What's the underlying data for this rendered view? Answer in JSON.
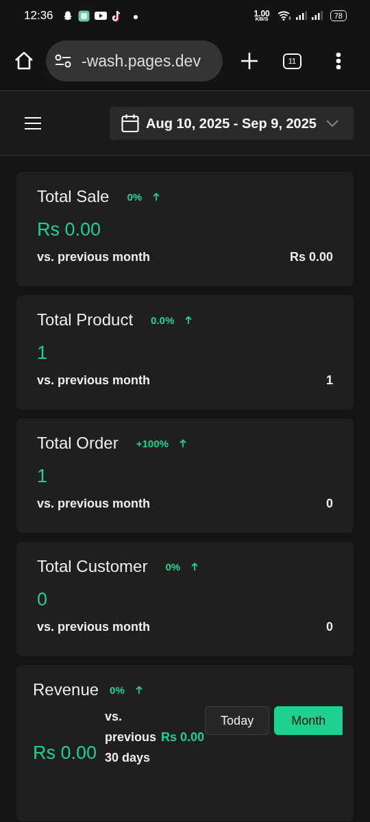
{
  "status_bar": {
    "time": "12:36",
    "speed_value": "1.00",
    "speed_unit": "KB/S",
    "battery": "78"
  },
  "browser": {
    "url": "-wash.pages.dev",
    "tab_count": "11"
  },
  "header": {
    "date_range": "Aug 10, 2025 - Sep 9, 2025"
  },
  "stats": [
    {
      "title": "Total Sale",
      "change": "0%",
      "rising": true,
      "value": "Rs 0.00",
      "comparison": "vs. previous month",
      "previous": "Rs 0.00"
    },
    {
      "title": "Total Product",
      "change": "0.0%",
      "rising": true,
      "value": "1",
      "comparison": "vs. previous month",
      "previous": "1"
    },
    {
      "title": "Total Order",
      "change": "+100%",
      "rising": true,
      "value": "1",
      "comparison": "vs. previous month",
      "previous": "0"
    },
    {
      "title": "Total Customer",
      "change": "0%",
      "rising": true,
      "value": "0",
      "comparison": "vs. previous month",
      "previous": "0"
    }
  ],
  "revenue": {
    "title": "Revenue",
    "change": "0%",
    "rising": true,
    "value": "Rs 0.00",
    "comparison": "vs. previous 30 days",
    "previous": "Rs 0.00",
    "periods": [
      {
        "label": "Today",
        "selected": false
      },
      {
        "label": "Month",
        "selected": true
      }
    ]
  }
}
